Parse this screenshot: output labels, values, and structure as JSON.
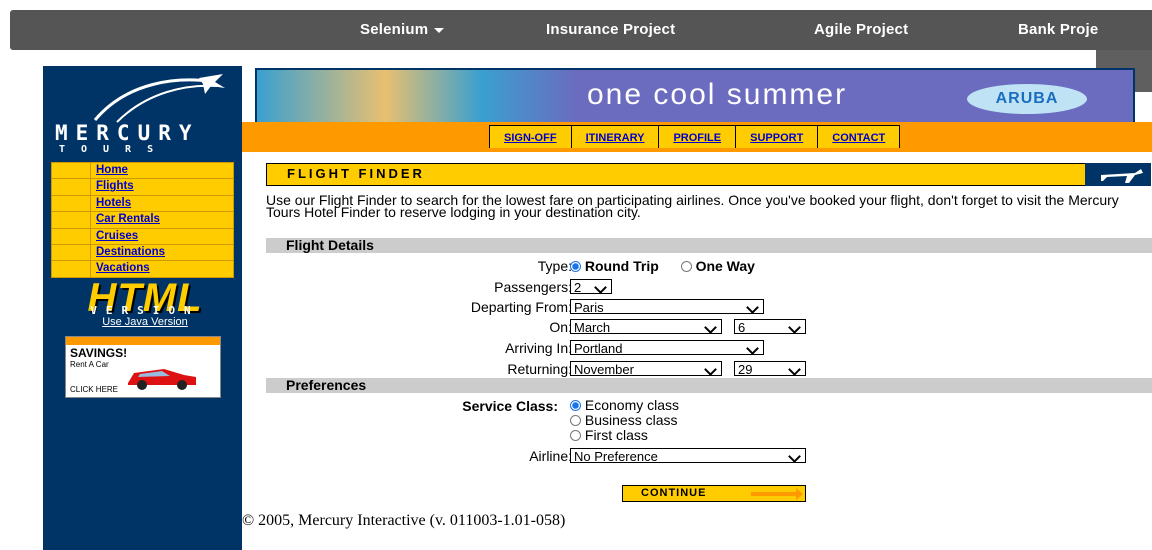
{
  "topnav": {
    "items": [
      "Selenium",
      "Insurance Project",
      "Agile Project",
      "Bank Proje"
    ]
  },
  "logo": {
    "word": "MERCURY",
    "sub": "TOURS"
  },
  "sidebar": {
    "menu": [
      "Home",
      "Flights",
      "Hotels",
      "Car Rentals",
      "Cruises",
      "Destinations",
      "Vacations"
    ],
    "html_badge": "HTML",
    "html_version": "VERSION",
    "java_link": "Use Java Version",
    "ad": {
      "title": "SAVINGS!",
      "subtitle": "Rent A Car",
      "cta": "CLICK HERE"
    }
  },
  "banner": {
    "text": "one cool summer",
    "brand": "ARUBA"
  },
  "tabs": [
    "SIGN-OFF",
    "ITINERARY",
    "PROFILE",
    "SUPPORT",
    "CONTACT"
  ],
  "finder": {
    "title": "FLIGHT FINDER",
    "intro": "Use our Flight Finder to search for the lowest fare on participating airlines. Once you've booked your flight, don't forget to visit the Mercury Tours Hotel Finder to reserve lodging in your destination city.",
    "section_details": "Flight Details",
    "type_label": "Type:",
    "type_options": [
      "Round Trip",
      "One Way"
    ],
    "type_selected": "Round Trip",
    "passengers_label": "Passengers:",
    "passengers_value": "2",
    "from_label": "Departing From:",
    "from_value": "Paris",
    "on_label": "On:",
    "on_month": "March",
    "on_day": "6",
    "arriving_label": "Arriving In:",
    "arriving_value": "Portland",
    "returning_label": "Returning:",
    "returning_month": "November",
    "returning_day": "29",
    "section_prefs": "Preferences",
    "class_label": "Service Class:",
    "class_options": [
      "Economy class",
      "Business class",
      "First class"
    ],
    "class_selected": "Economy class",
    "airline_label": "Airline:",
    "airline_value": "No Preference",
    "continue_label": "CONTINUE"
  },
  "footer": {
    "copyright": "© 2005, Mercury Interactive (v. 011003-1.01-058)"
  },
  "colors": {
    "navy": "#003366",
    "yellow": "#FFCC00",
    "orange": "#FF9900",
    "link": "#0000CC",
    "topnav": "#555555"
  }
}
